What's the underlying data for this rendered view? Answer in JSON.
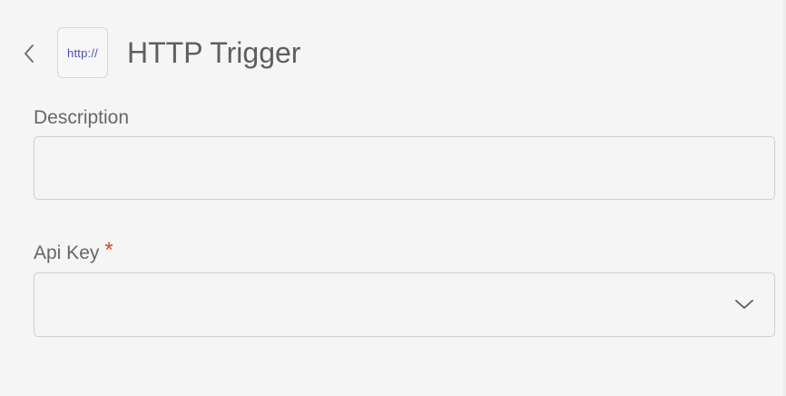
{
  "header": {
    "back_icon": "chevron-left-icon",
    "trigger_icon_text": "http://",
    "title": "HTTP Trigger"
  },
  "form": {
    "description": {
      "label": "Description",
      "value": "",
      "placeholder": ""
    },
    "api_key": {
      "label": "Api Key",
      "required_marker": "*",
      "selected_value": "",
      "dropdown_icon": "chevron-down-icon"
    }
  },
  "colors": {
    "background": "#f5f5f5",
    "title_text": "#5e5e5e",
    "label_text": "#666666",
    "icon_text": "#4b50b8",
    "required": "#d9442e",
    "border": "#cfcfcf"
  }
}
